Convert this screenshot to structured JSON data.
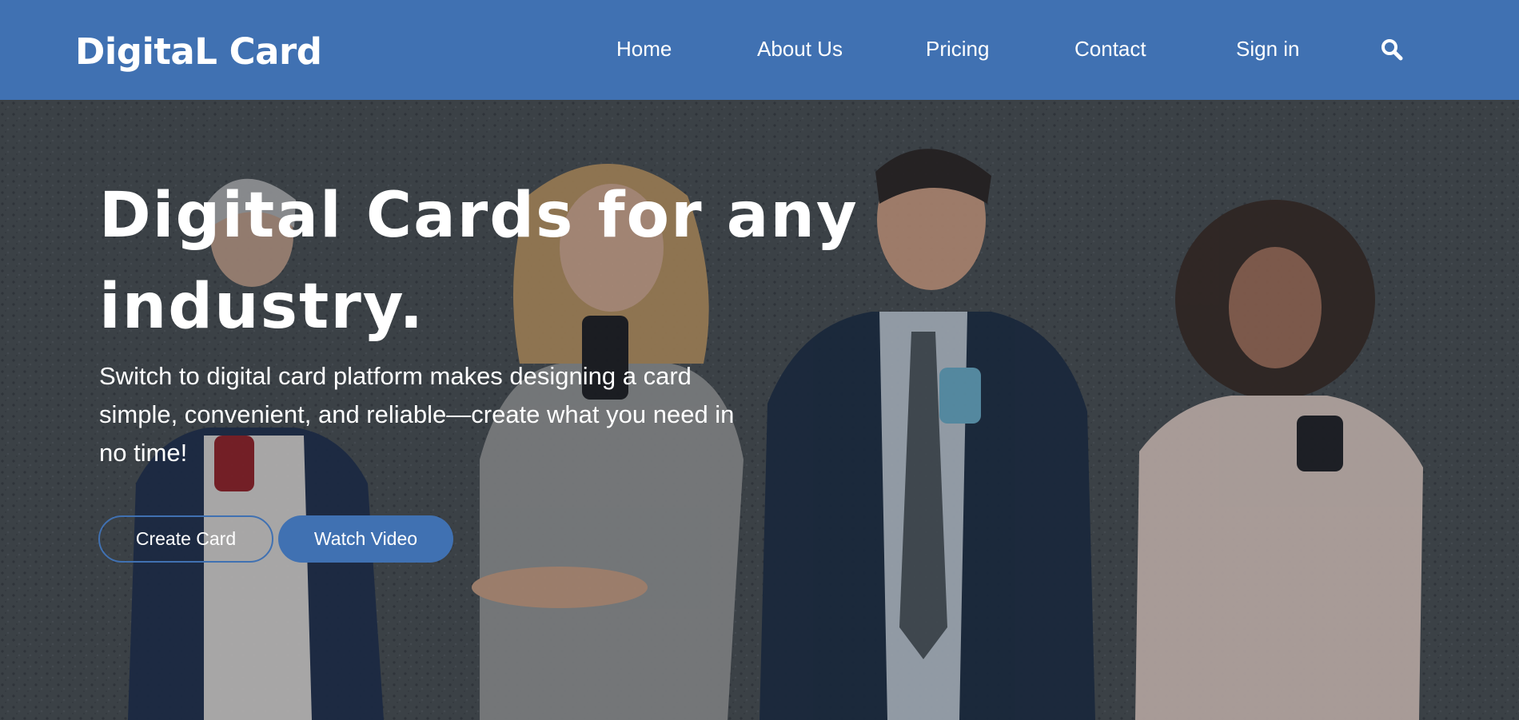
{
  "brand": {
    "name": "DigitaL Card"
  },
  "nav": {
    "items": [
      {
        "label": "Home"
      },
      {
        "label": "About Us"
      },
      {
        "label": "Pricing"
      },
      {
        "label": "Contact"
      },
      {
        "label": "Sign in"
      }
    ],
    "search_icon": "search-icon"
  },
  "hero": {
    "headline": "Digital Cards for any industry.",
    "subtext": "Switch to digital card platform makes designing a card simple, convenient, and reliable—create what you need in no time!",
    "primary_button": "Create Card",
    "secondary_button": "Watch Video",
    "background_image": "four-people-using-phones-against-textured-wall"
  },
  "colors": {
    "accent": "#4071b2",
    "text": "#ffffff",
    "background": "#3d4246"
  }
}
